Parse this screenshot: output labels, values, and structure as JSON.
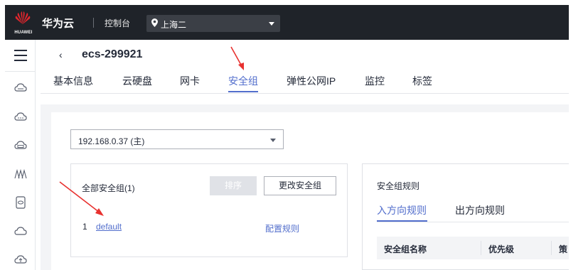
{
  "topbar": {
    "logo_text": "HUAWEI",
    "brand": "华为云",
    "console": "控制台",
    "region": "上海二",
    "icons": [
      "huawei-logo",
      "location-pin-icon",
      "chevron-down-icon"
    ]
  },
  "rail": {
    "icons": [
      "menu-icon",
      "cloud-server-icon",
      "cloud-icon",
      "storage-icon",
      "network-icon",
      "database-icon",
      "cloud-outline-icon",
      "cloud-upload-icon"
    ]
  },
  "header": {
    "back_icon": "‹",
    "title": "ecs-299921"
  },
  "tabs": [
    {
      "label": "基本信息"
    },
    {
      "label": "云硬盘"
    },
    {
      "label": "网卡"
    },
    {
      "label": "安全组",
      "active": true
    },
    {
      "label": "弹性公网IP"
    },
    {
      "label": "监控"
    },
    {
      "label": "标签"
    }
  ],
  "ip_select": {
    "value": "192.168.0.37 (主)"
  },
  "security_groups": {
    "heading": "全部安全组(1)",
    "sort_button": "排序",
    "change_button": "更改安全组",
    "rows": [
      {
        "index": "1",
        "name": "default",
        "action": "配置规则"
      }
    ]
  },
  "rules": {
    "title": "安全组规则",
    "tabs": [
      "入方向规则",
      "出方向规则"
    ],
    "columns": [
      "安全组名称",
      "优先级",
      "策"
    ]
  },
  "colors": {
    "accent": "#526ecc",
    "topbar": "#1f2329",
    "annotation_arrow": "#e8312f"
  }
}
